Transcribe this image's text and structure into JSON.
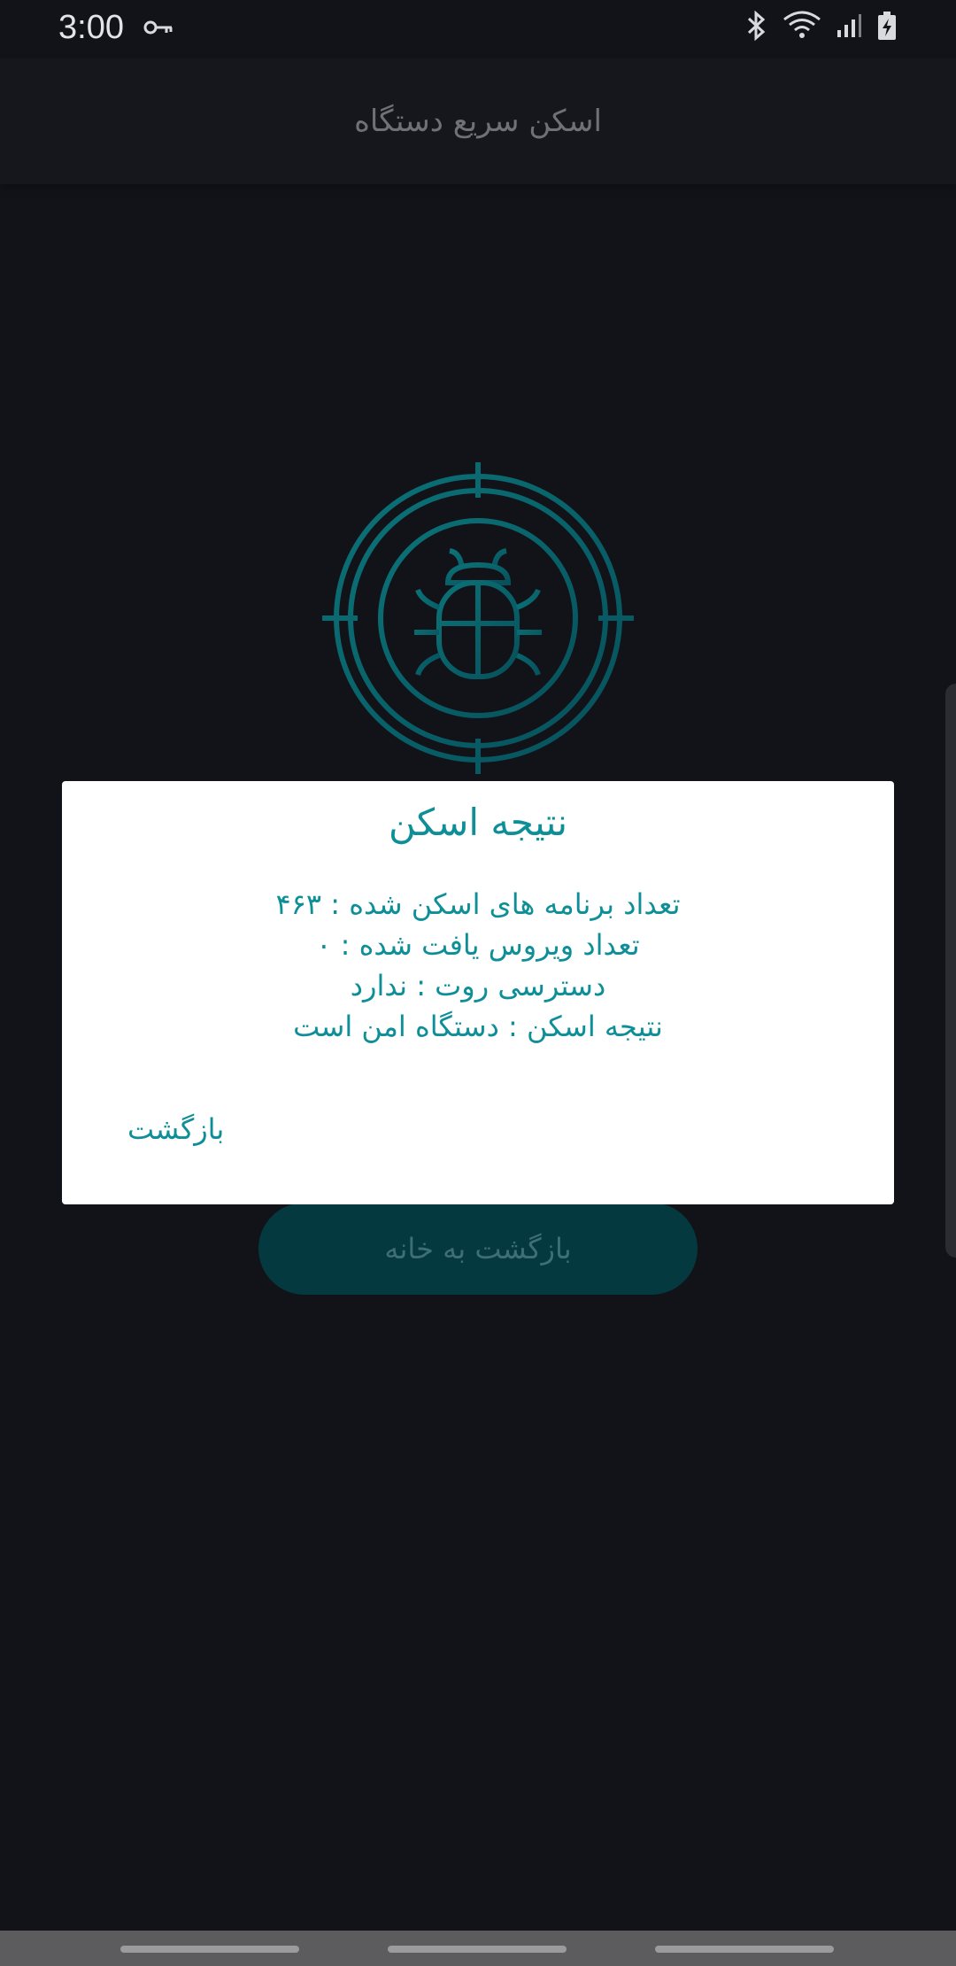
{
  "status_bar": {
    "time": "3:00",
    "icons": [
      "vpn-key-icon",
      "bluetooth-icon",
      "wifi-icon",
      "signal-icon",
      "battery-charging-icon"
    ]
  },
  "app_bar": {
    "title": "اسکن سریع دستگاه"
  },
  "emblem": {
    "icon": "bug-target-icon",
    "colors": [
      "#0b6f74",
      "#07525d"
    ]
  },
  "home_button": {
    "label": "بازگشت به خانه"
  },
  "dialog": {
    "title": "نتیجه اسکن",
    "lines": [
      "تعداد برنامه های اسکن شده : ۴۶۳",
      "تعداد ویروس یافت شده : ۰",
      "دسترسی روت : ندارد",
      "نتیجه اسکن : دستگاه امن است"
    ],
    "back_label": "بازگشت"
  },
  "colors": {
    "accent": "#0e8f98",
    "background": "#121318"
  }
}
